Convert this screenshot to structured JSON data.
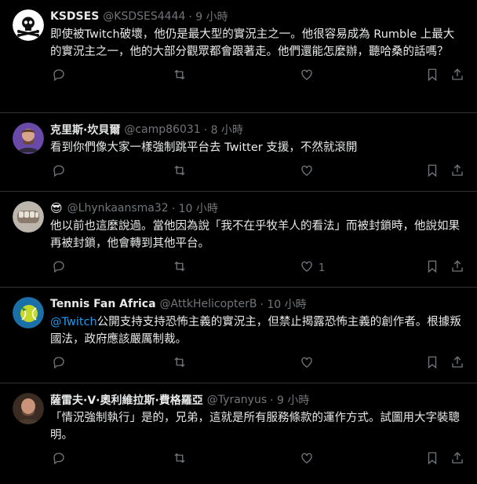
{
  "tweets": [
    {
      "name": "KSDSES",
      "handle": "@KSDSES4444",
      "time": "· 9 小時",
      "avatar": "skull-avatar",
      "body": "即使被Twitch破壞，他仍是最大型的實況主之一。他很容易成為 Rumble 上最大的實況主之一，他的大部分觀眾都會跟著走。他們還能怎麼辦，聽哈桑的話嗎？",
      "likes": ""
    },
    {
      "name": "克里斯·坎貝爾",
      "handle": "@camp86031",
      "time": "· 8 小時",
      "avatar": "person-avatar",
      "body": "看到你們像大家一樣強制跳平台去 Twitter 支援，不然就滾開",
      "likes": ""
    },
    {
      "name": "",
      "emoji": "😎",
      "handle": "@Lhynkaansma32",
      "time": "· 10 小時",
      "avatar": "fist-avatar",
      "body": "他以前也這麼說過。當他因為說「我不在乎牧羊人的看法」而被封鎖時，他說如果再被封鎖，他會轉到其他平台。",
      "likes": "1"
    },
    {
      "name": "Tennis Fan Africa",
      "handle": "@AttkHelicopterB",
      "time": "· 10 小時",
      "avatar": "tennis-avatar",
      "mention": "@Twitch",
      "body": "公開支持支持恐怖主義的實況主，但禁止揭露恐怖主義的創作者。根據叛國法，政府應該嚴厲制裁。",
      "likes": ""
    },
    {
      "name": "薩雷夫·V·奧利維拉斯·費格羅亞",
      "handle": "@Tyranyus",
      "time": "· 9 小時",
      "avatar": "bald-man-avatar",
      "body": "「情況強制執行」是的，兄弟，這就是所有服務條款的運作方式。試圖用大字裝聰明。",
      "likes": ""
    }
  ],
  "colors": {
    "background": "#000000",
    "text": "#e7e9ea",
    "muted": "#71767b",
    "link": "#1d9bf0",
    "divider": "#2f3336"
  },
  "icons": [
    "reply-icon",
    "retweet-icon",
    "like-icon",
    "bookmark-icon",
    "share-icon"
  ]
}
